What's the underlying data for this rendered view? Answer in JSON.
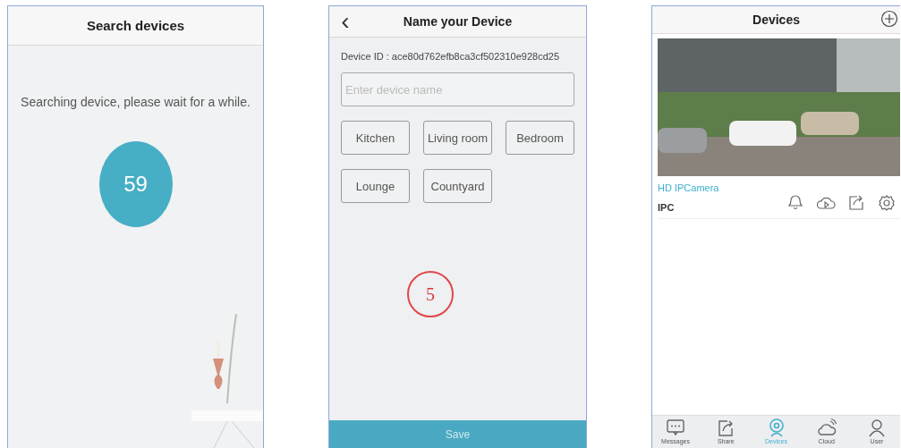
{
  "search_screen": {
    "title": "Search devices",
    "message": "Searching device, please wait for a while.",
    "countdown": "59"
  },
  "name_screen": {
    "back_icon": "‹",
    "title": "Name your Device",
    "device_id": "Device ID : ace80d762efb8ca3cf502310e928cd25",
    "name_field": {
      "placeholder": "Enter device name"
    },
    "name_suggestions": [
      "Kitchen",
      "Living room",
      "Bedroom",
      "Lounge",
      "Countyard"
    ],
    "annotation": "5",
    "save_button": "Save"
  },
  "devices_screen": {
    "title": "Devices",
    "device": {
      "name": "HD IPCamera",
      "type": "IPC"
    },
    "tab_bar": [
      {
        "label": "Messages",
        "selected": false
      },
      {
        "label": "Share",
        "selected": false
      },
      {
        "label": "Devices",
        "selected": true
      },
      {
        "label": "Cloud",
        "selected": false
      },
      {
        "label": "User",
        "selected": false
      }
    ]
  }
}
